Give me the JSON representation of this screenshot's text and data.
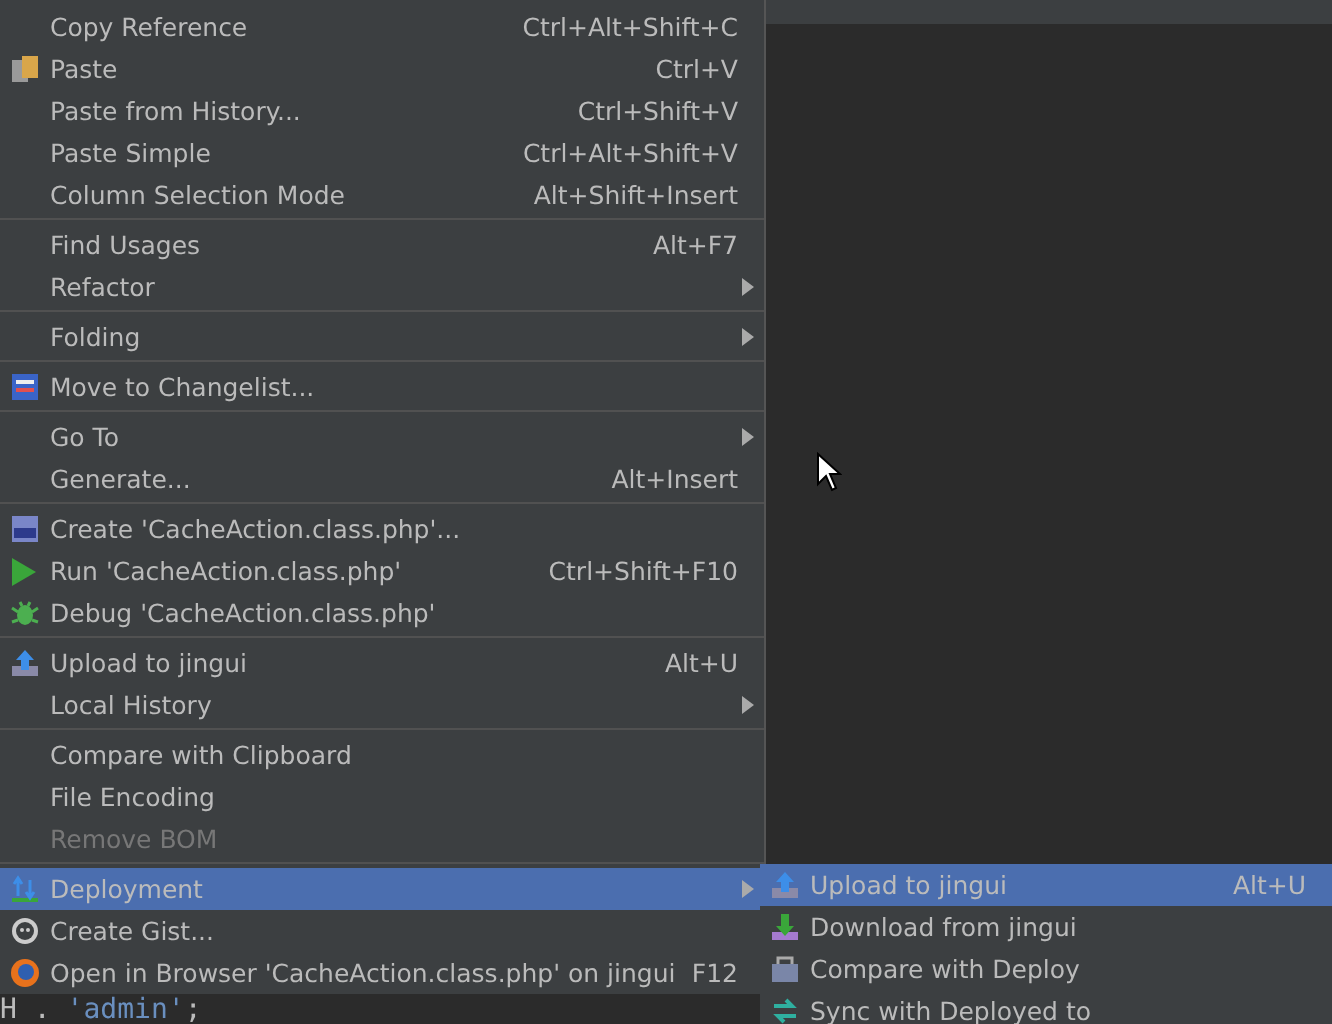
{
  "menu": {
    "groups": [
      [
        {
          "label": "Copy Reference",
          "shortcut": "Ctrl+Alt+Shift+C",
          "has_submenu": false,
          "disabled": false,
          "selected": false
        },
        {
          "label": "Paste",
          "shortcut": "Ctrl+V",
          "has_submenu": false,
          "disabled": false,
          "selected": false
        },
        {
          "label": "Paste from History...",
          "shortcut": "Ctrl+Shift+V",
          "has_submenu": false,
          "disabled": false,
          "selected": false
        },
        {
          "label": "Paste Simple",
          "shortcut": "Ctrl+Alt+Shift+V",
          "has_submenu": false,
          "disabled": false,
          "selected": false
        },
        {
          "label": "Column Selection Mode",
          "shortcut": "Alt+Shift+Insert",
          "has_submenu": false,
          "disabled": false,
          "selected": false
        }
      ],
      [
        {
          "label": "Find Usages",
          "shortcut": "Alt+F7",
          "has_submenu": false,
          "disabled": false,
          "selected": false
        },
        {
          "label": "Refactor",
          "has_submenu": true,
          "disabled": false,
          "selected": false
        }
      ],
      [
        {
          "label": "Folding",
          "has_submenu": true,
          "disabled": false,
          "selected": false
        }
      ],
      [
        {
          "label": "Move to Changelist...",
          "has_submenu": false,
          "disabled": false,
          "selected": false
        }
      ],
      [
        {
          "label": "Go To",
          "has_submenu": true,
          "disabled": false,
          "selected": false
        },
        {
          "label": "Generate...",
          "shortcut": "Alt+Insert",
          "has_submenu": false,
          "disabled": false,
          "selected": false
        }
      ],
      [
        {
          "label": "Create 'CacheAction.class.php'...",
          "has_submenu": false,
          "disabled": false,
          "selected": false
        },
        {
          "label": "Run 'CacheAction.class.php'",
          "shortcut": "Ctrl+Shift+F10",
          "has_submenu": false,
          "disabled": false,
          "selected": false
        },
        {
          "label": "Debug 'CacheAction.class.php'",
          "has_submenu": false,
          "disabled": false,
          "selected": false
        }
      ],
      [
        {
          "label": "Upload to jingui",
          "shortcut": "Alt+U",
          "has_submenu": false,
          "disabled": false,
          "selected": false
        },
        {
          "label": "Local History",
          "has_submenu": true,
          "disabled": false,
          "selected": false
        }
      ],
      [
        {
          "label": "Compare with Clipboard",
          "has_submenu": false,
          "disabled": false,
          "selected": false
        },
        {
          "label": "File Encoding",
          "has_submenu": false,
          "disabled": false,
          "selected": false
        },
        {
          "label": "Remove BOM",
          "has_submenu": false,
          "disabled": true,
          "selected": false
        }
      ],
      [
        {
          "label": "Deployment",
          "has_submenu": true,
          "disabled": false,
          "selected": true
        },
        {
          "label": "Create Gist...",
          "has_submenu": false,
          "disabled": false,
          "selected": false
        },
        {
          "label": "Open in Browser 'CacheAction.class.php' on jingui",
          "shortcut": "F12",
          "has_submenu": false,
          "disabled": false,
          "selected": false
        }
      ]
    ]
  },
  "submenu": {
    "items": [
      {
        "label": "Upload to jingui",
        "shortcut": "Alt+U",
        "selected": true
      },
      {
        "label": "Download from jingui",
        "selected": false
      },
      {
        "label": "Compare with Deploy",
        "selected": false
      },
      {
        "label": "Sync with Deployed to",
        "selected": false
      }
    ]
  },
  "code_line": [
    {
      "text": "H .",
      "kind": "plain"
    },
    {
      "text": "'admin'",
      "kind": "string"
    },
    {
      "text": ";",
      "kind": "plain"
    }
  ]
}
